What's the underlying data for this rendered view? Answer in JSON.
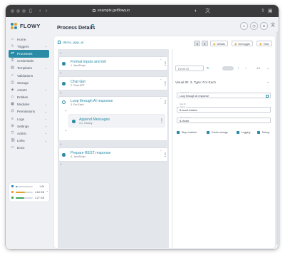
{
  "browser": {
    "url": "example.getflowy.io"
  },
  "brand": {
    "name": "FLOWY",
    "accent": "#2a8ba7"
  },
  "sidebar": {
    "items": [
      {
        "label": "Home",
        "icon": "home-icon",
        "active": false,
        "expandable": false
      },
      {
        "label": "Triggers",
        "icon": "lightning-icon",
        "active": false,
        "expandable": true
      },
      {
        "label": "Processes",
        "icon": "process-icon",
        "active": true,
        "expandable": false
      },
      {
        "label": "Credentials",
        "icon": "key-icon",
        "active": false,
        "expandable": false
      },
      {
        "label": "Templates",
        "icon": "template-icon",
        "active": false,
        "expandable": true
      },
      {
        "label": "Validations",
        "icon": "check-icon",
        "active": false,
        "expandable": false
      },
      {
        "label": "Storage",
        "icon": "database-icon",
        "active": false,
        "expandable": false
      },
      {
        "label": "Assets",
        "icon": "asset-icon",
        "active": false,
        "expandable": true
      },
      {
        "label": "Entities",
        "icon": "entity-icon",
        "active": false,
        "expandable": false
      },
      {
        "label": "Modules",
        "icon": "module-icon",
        "active": false,
        "expandable": true
      },
      {
        "label": "Permissions",
        "icon": "lock-icon",
        "active": false,
        "expandable": true
      },
      {
        "label": "Logs",
        "icon": "log-icon",
        "active": false,
        "expandable": true
      },
      {
        "label": "Settings",
        "icon": "gear-icon",
        "active": false,
        "expandable": true
      },
      {
        "label": "Admin",
        "icon": "shield-icon",
        "active": false,
        "expandable": true
      },
      {
        "label": "Links",
        "icon": "link-icon",
        "active": false,
        "expandable": true
      },
      {
        "label": "Docs",
        "icon": "doc-icon",
        "active": false,
        "expandable": false
      }
    ]
  },
  "storage": {
    "rows": [
      {
        "value": "1.0k",
        "color": "#2a8ba7",
        "fill": 0.1
      },
      {
        "value": "4.84 GB",
        "color": "#e0a22b",
        "fill": 0.55
      },
      {
        "value": "4.27 GB",
        "color": "#3aa65a",
        "fill": 0.48
      }
    ]
  },
  "header": {
    "title": "Process Details"
  },
  "process": {
    "app_name": "demo_app_ai",
    "actions": {
      "details": "Details",
      "debugger": "Debugger",
      "view": "View"
    },
    "steps": [
      {
        "title": "Format inputs and init",
        "sub": "1. JavaScript"
      },
      {
        "title": "Chat Gpt",
        "sub": "2. Chat GPT"
      },
      {
        "title": "Loop through AI response",
        "sub": "3. For Each"
      },
      {
        "title": "Append Messages",
        "sub": "3.1. Groovy"
      },
      {
        "title": "Prepare REST response",
        "sub": "4. JavaScript"
      }
    ]
  },
  "panel": {
    "event_id_placeholder": "Event ID",
    "zoom": "1/1",
    "visual_id": "Visual ID: 3, Type: For Each",
    "fields": [
      {
        "label": "Step Name",
        "value": "Loop through AI response"
      },
      {
        "label": "Step ID",
        "value": ""
      },
      {
        "label": "Query",
        "value": "$.result.choices"
      },
      {
        "label": "Record Name",
        "value": "$.choice"
      }
    ],
    "checkboxes": [
      "Step enabled",
      "Cache storage",
      "Logging",
      "Debug"
    ]
  }
}
